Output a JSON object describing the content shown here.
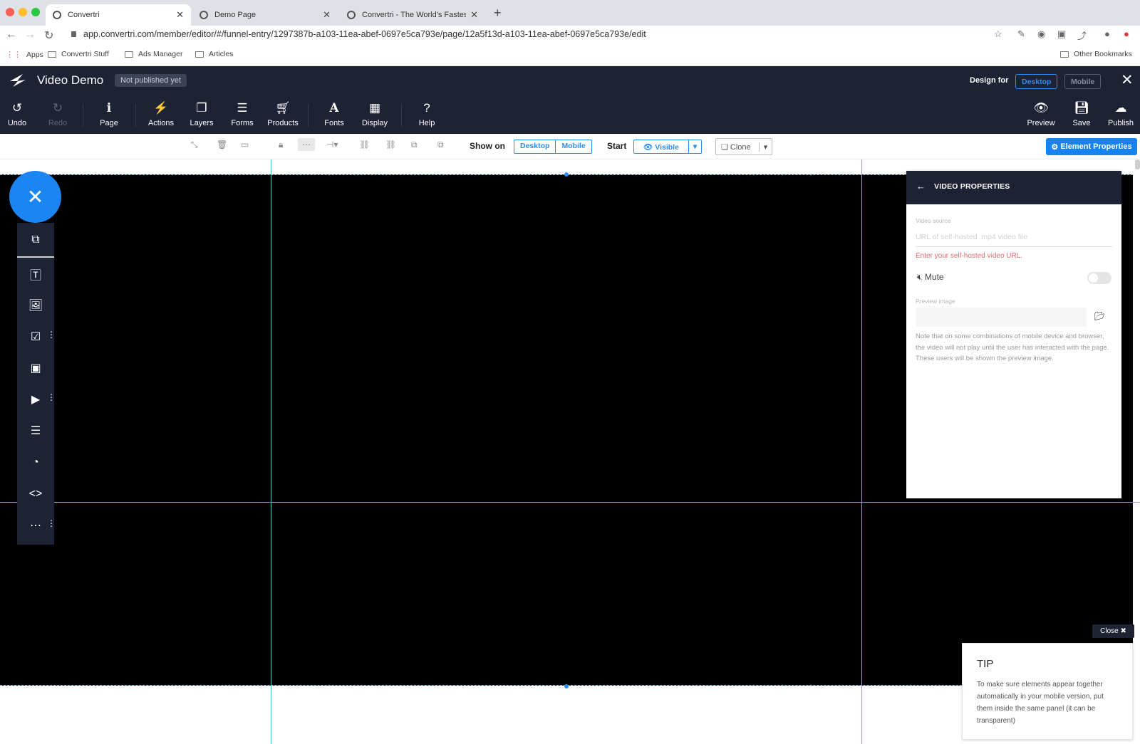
{
  "browser": {
    "tabs": [
      {
        "label": "Convertri",
        "active": true
      },
      {
        "label": "Demo Page",
        "active": false
      },
      {
        "label": "Convertri - The World's Fastest",
        "active": false
      }
    ],
    "url": "app.convertri.com/member/editor/#/funnel-entry/1297387b-a103-11ea-abef-0697e5ca793e/page/12a5f13d-a103-11ea-abef-0697e5ca793e/edit",
    "bookmarks": [
      "Apps",
      "Convertri Stuff",
      "Ads Manager",
      "Articles"
    ],
    "other_bookmarks": "Other Bookmarks"
  },
  "header": {
    "title": "Video Demo",
    "status": "Not published yet",
    "design_for_label": "Design for",
    "design_for_options": [
      "Desktop",
      "Mobile"
    ],
    "design_for_selected": "Desktop"
  },
  "toolbar": {
    "left": [
      {
        "label": "Undo",
        "icon": "undo-icon"
      },
      {
        "label": "Redo",
        "icon": "redo-icon",
        "disabled": true
      },
      {
        "label": "Page",
        "icon": "info-icon"
      },
      {
        "label": "Actions",
        "icon": "magic-wand-icon"
      },
      {
        "label": "Layers",
        "icon": "layers-icon"
      },
      {
        "label": "Forms",
        "icon": "list-icon"
      },
      {
        "label": "Products",
        "icon": "cart-icon"
      },
      {
        "label": "Fonts",
        "icon": "font-icon"
      },
      {
        "label": "Display",
        "icon": "grid-icon"
      },
      {
        "label": "Help",
        "icon": "help-icon"
      }
    ],
    "right": [
      {
        "label": "Preview",
        "icon": "eye-icon"
      },
      {
        "label": "Save",
        "icon": "save-icon"
      },
      {
        "label": "Publish",
        "icon": "cloud-upload-icon"
      }
    ]
  },
  "subbar": {
    "show_on_label": "Show on",
    "show_on_options": [
      "Desktop",
      "Mobile"
    ],
    "start_label": "Start",
    "start_value": "Visible",
    "clone_label": "Clone",
    "element_properties_label": "Element Properties"
  },
  "video_properties": {
    "title": "VIDEO PROPERTIES",
    "source_label": "Video source",
    "source_placeholder": "URL of self-hosted .mp4 video file",
    "source_error": "Enter your self-hosted video URL.",
    "mute_label": "Mute",
    "mute_on": false,
    "preview_image_label": "Preview image",
    "note": "Note that on some combinations of mobile device and browser, the video will not play until the user has interacted with the page. These users will be shown the preview image."
  },
  "tip": {
    "close_label": "Close",
    "title": "TIP",
    "body": "To make sure elements appear together automatically in your mobile version, put them inside the same panel (it can be transparent)"
  },
  "colors": {
    "brand_dark": "#1d2235",
    "accent": "#1b86f3",
    "guide": "#4fc3d4"
  }
}
